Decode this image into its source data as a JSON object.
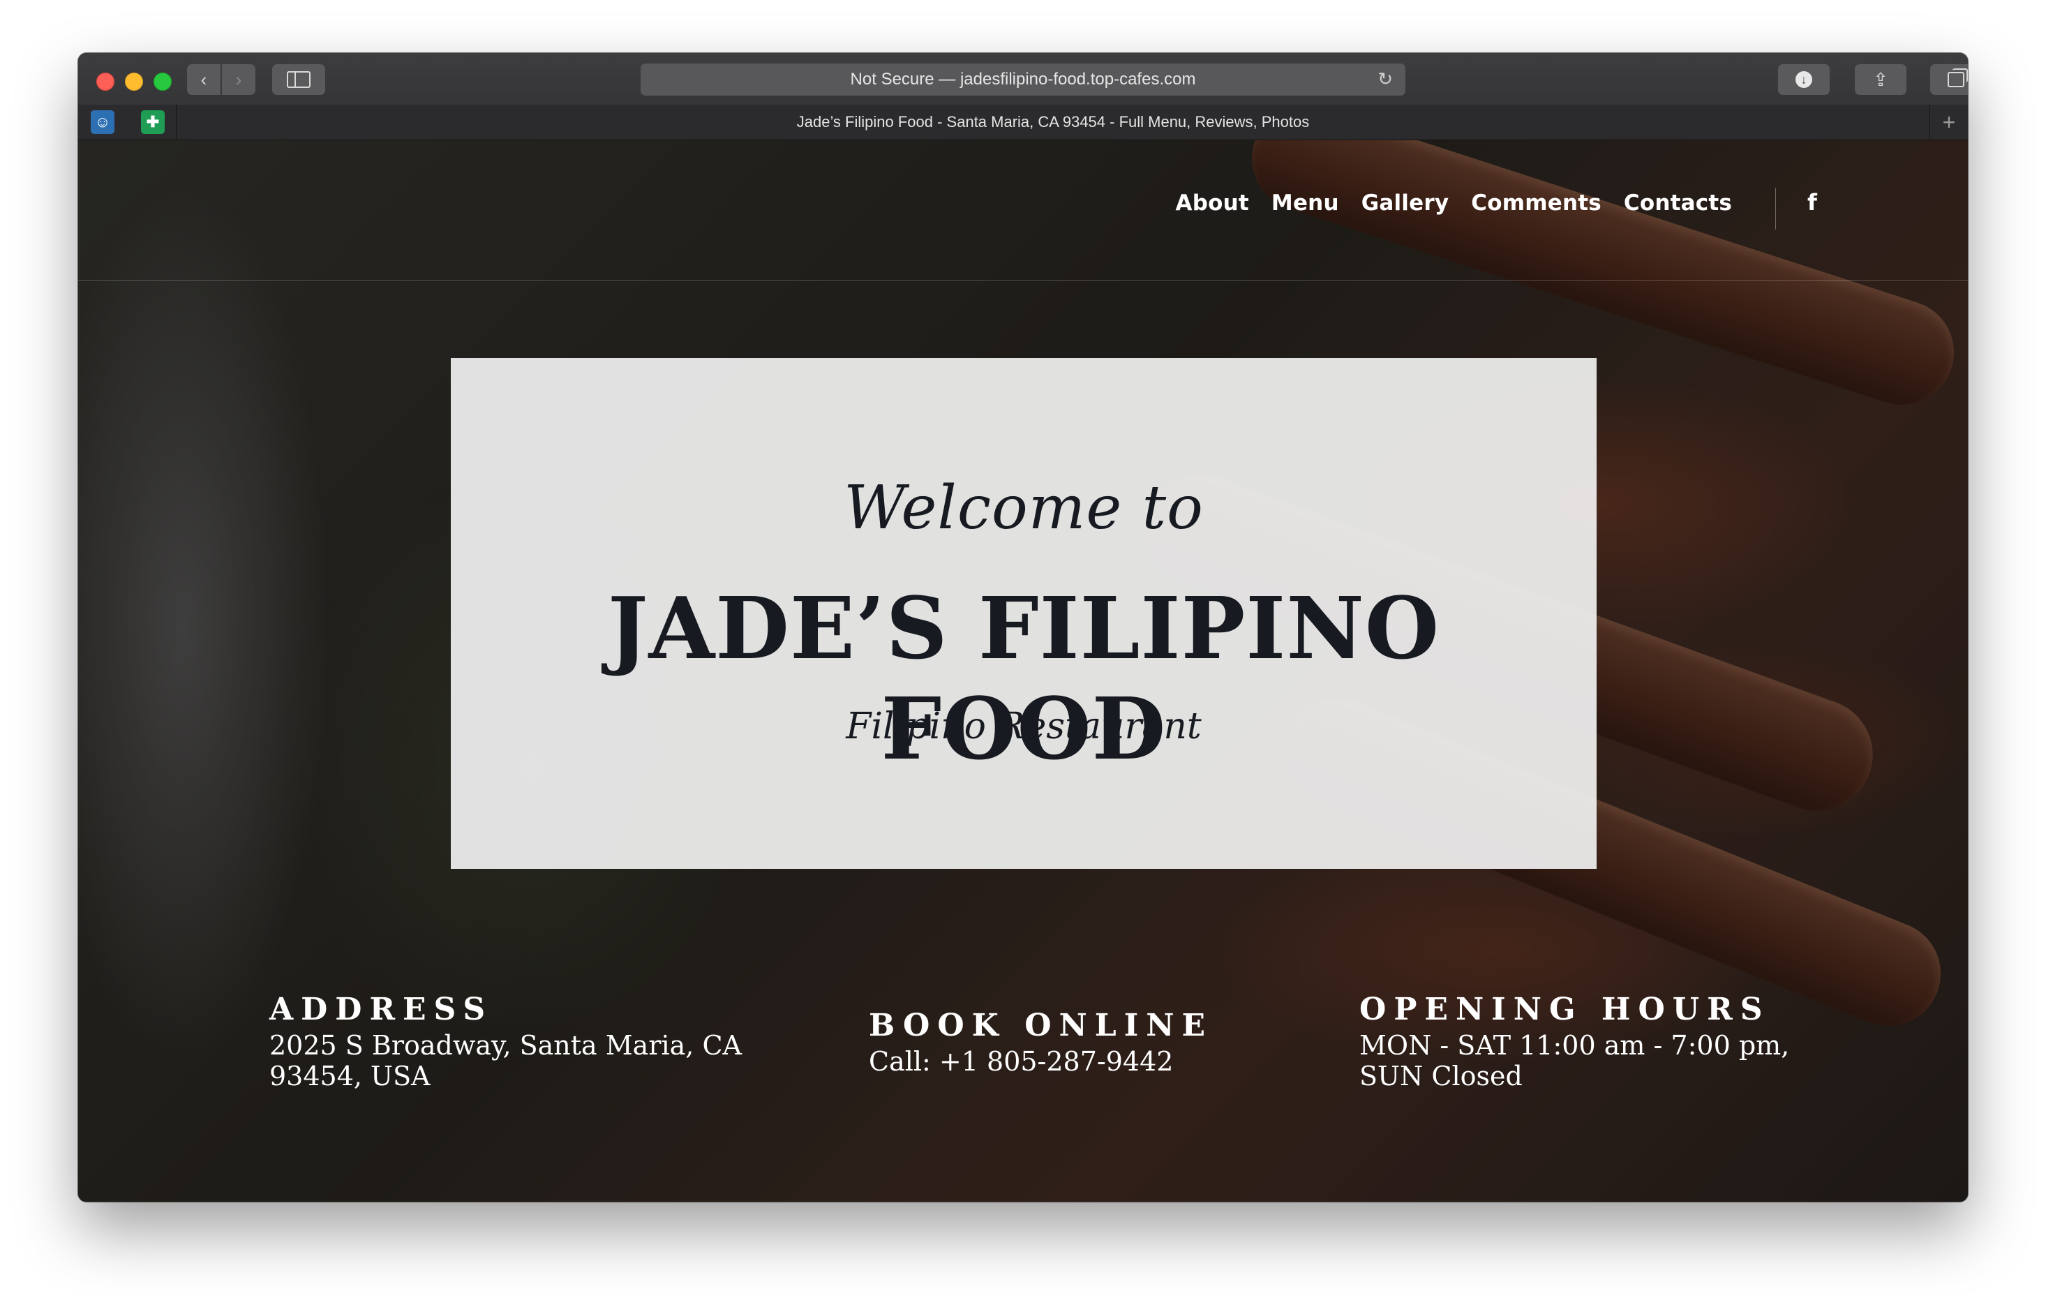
{
  "browser": {
    "address": "Not Secure — jadesfilipino-food.top-cafes.com",
    "tab_title": "Jade’s Filipino Food - Santa Maria, CA 93454 - Full Menu, Reviews, Photos",
    "new_tab": "+"
  },
  "nav": {
    "items": [
      "About",
      "Menu",
      "Gallery",
      "Comments",
      "Contacts"
    ],
    "social": "f"
  },
  "hero": {
    "welcome": "Welcome to",
    "name": "JADE’S FILIPINO FOOD",
    "tagline": "Filipino Restaurant"
  },
  "info": {
    "address": {
      "heading": "ADDRESS",
      "text": "2025 S Broadway, Santa Maria, CA 93454, USA"
    },
    "book": {
      "heading": "BOOK ONLINE",
      "text": "Call: +1 805-287-9442"
    },
    "hours": {
      "heading": "OPENING HOURS",
      "text": "MON - SAT 11:00 am - 7:00 pm, SUN Closed"
    }
  }
}
